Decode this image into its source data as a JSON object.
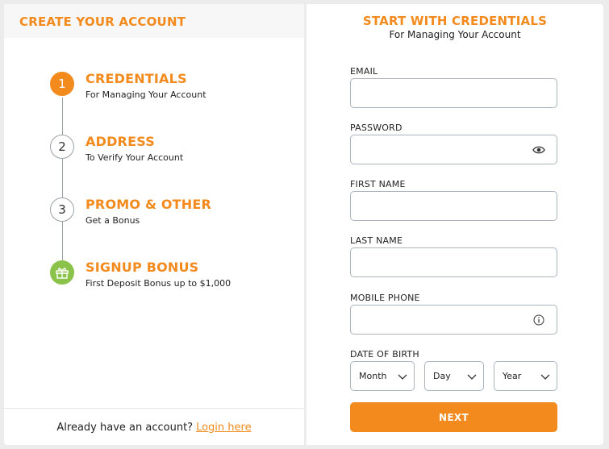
{
  "left": {
    "title": "CREATE YOUR ACCOUNT",
    "steps": [
      {
        "number": "1",
        "title": "CREDENTIALS",
        "subtitle": "For Managing Your Account",
        "state": "active"
      },
      {
        "number": "2",
        "title": "ADDRESS",
        "subtitle": "To Verify Your Account",
        "state": "pending"
      },
      {
        "number": "3",
        "title": "PROMO & OTHER",
        "subtitle": "Get a Bonus",
        "state": "pending"
      },
      {
        "number": "",
        "title": "SIGNUP BONUS",
        "subtitle": "First Deposit Bonus up to $1,000",
        "state": "bonus",
        "icon": "gift-icon"
      }
    ],
    "footer": {
      "text": "Already have an account?",
      "link": "Login here"
    }
  },
  "right": {
    "title": "START WITH CREDENTIALS",
    "subtitle": "For Managing Your Account",
    "fields": {
      "email": {
        "label": "EMAIL",
        "value": ""
      },
      "password": {
        "label": "PASSWORD",
        "value": "",
        "icon": "eye-icon"
      },
      "first_name": {
        "label": "FIRST NAME",
        "value": ""
      },
      "last_name": {
        "label": "LAST NAME",
        "value": ""
      },
      "mobile_phone": {
        "label": "MOBILE PHONE",
        "value": "",
        "icon": "info-icon"
      }
    },
    "dob": {
      "label": "DATE OF BIRTH",
      "month": "Month",
      "day": "Day",
      "year": "Year"
    },
    "next_label": "NEXT"
  },
  "colors": {
    "accent": "#f28a1d",
    "bonus": "#8bc34a",
    "border": "#aab4be"
  }
}
